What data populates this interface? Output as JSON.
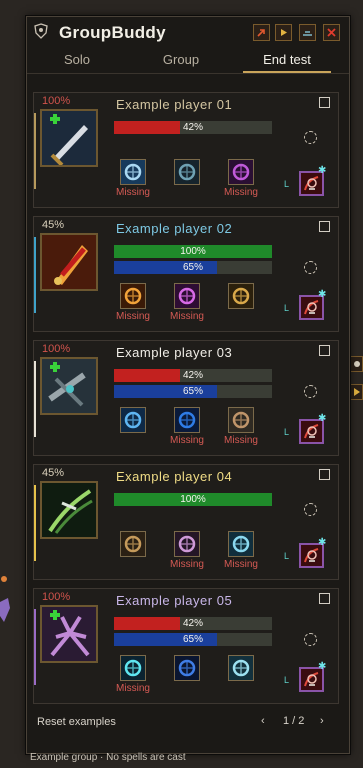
{
  "app": {
    "title": "GroupBuddy",
    "icons": [
      "shield-logo-icon",
      "popout-icon",
      "play-icon",
      "minimize-icon",
      "close-icon"
    ]
  },
  "tabs": [
    {
      "label": "Solo",
      "active": false
    },
    {
      "label": "Group",
      "active": false
    },
    {
      "label": "End test",
      "active": true
    }
  ],
  "players": [
    {
      "name": "Example player 01",
      "name_color": "#d4c6a2",
      "percent": "100%",
      "percent_color": "#d0534c",
      "accent_color": "#b79a5c",
      "portrait": "sword-icon",
      "bars": [
        {
          "label": "42%",
          "value": 0.42,
          "color": "#c2211f"
        }
      ],
      "spells": [
        {
          "icon": "crystal-ward-icon",
          "missing": true
        },
        {
          "icon": "pillar-rune-icon",
          "missing": false
        },
        {
          "icon": "arcane-portal-icon",
          "missing": true
        }
      ],
      "missing_label": "Missing",
      "level_label": "L"
    },
    {
      "name": "Example player 02",
      "name_color": "#7ec9e4",
      "percent": "45%",
      "percent_color": "#d9d0bb",
      "accent_color": "#3fa3c9",
      "portrait": "flame-blade-icon",
      "bars": [
        {
          "label": "100%",
          "value": 1.0,
          "color": "#1f8a2a"
        },
        {
          "label": "65%",
          "value": 0.65,
          "color": "#1a3f9c"
        }
      ],
      "spells": [
        {
          "icon": "fire-castle-icon",
          "missing": true
        },
        {
          "icon": "purple-hand-icon",
          "missing": true
        },
        {
          "icon": "golden-ear-icon",
          "missing": false
        }
      ],
      "missing_label": "Missing",
      "level_label": "L"
    },
    {
      "name": "Example player 03",
      "name_color": "#f1eee8",
      "percent": "100%",
      "percent_color": "#d0534c",
      "accent_color": "#e7e2d6",
      "portrait": "crossbow-icon",
      "bars": [
        {
          "label": "42%",
          "value": 0.42,
          "color": "#c2211f"
        },
        {
          "label": "65%",
          "value": 0.65,
          "color": "#1a3f9c"
        }
      ],
      "spells": [
        {
          "icon": "frost-hand-icon",
          "missing": false
        },
        {
          "icon": "blue-shield-icon",
          "missing": true
        },
        {
          "icon": "stone-golem-icon",
          "missing": true
        }
      ],
      "missing_label": "Missing",
      "level_label": "L"
    },
    {
      "name": "Example player 04",
      "name_color": "#f0dc86",
      "percent": "45%",
      "percent_color": "#d9d0bb",
      "accent_color": "#e6c24b",
      "portrait": "poison-claw-icon",
      "bars": [
        {
          "label": "100%",
          "value": 1.0,
          "color": "#1f8a2a"
        }
      ],
      "spells": [
        {
          "icon": "bronze-rune-icon",
          "missing": false
        },
        {
          "icon": "skull-orb-icon",
          "missing": true
        },
        {
          "icon": "ice-shard-icon",
          "missing": true
        }
      ],
      "missing_label": "Missing",
      "level_label": "L"
    },
    {
      "name": "Example player 05",
      "name_color": "#c8b6e8",
      "percent": "100%",
      "percent_color": "#d0534c",
      "accent_color": "#9a6bc6",
      "portrait": "coral-spikes-icon",
      "bars": [
        {
          "label": "42%",
          "value": 0.42,
          "color": "#c2211f"
        },
        {
          "label": "65%",
          "value": 0.65,
          "color": "#1a3f9c"
        }
      ],
      "spells": [
        {
          "icon": "cyan-flame-icon",
          "missing": true
        },
        {
          "icon": "blue-ring-icon",
          "missing": false
        },
        {
          "icon": "frost-burst-icon",
          "missing": false
        }
      ],
      "missing_label": "Missing",
      "level_label": "L"
    }
  ],
  "footer": {
    "reset_label": "Reset examples",
    "page_label": "1 / 2",
    "prev_icon": "chevron-left-icon",
    "next_icon": "chevron-right-icon"
  },
  "status": "Example group · No spells are cast"
}
